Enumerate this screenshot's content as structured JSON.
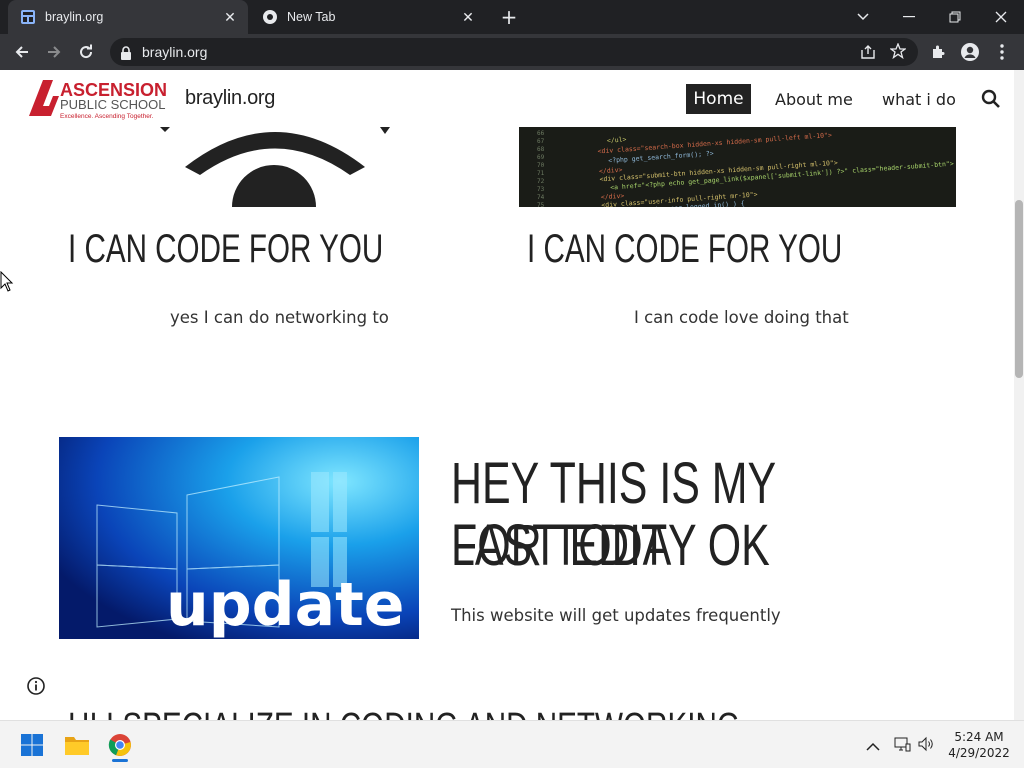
{
  "browser": {
    "tabs": [
      {
        "title": "braylin.org",
        "active": true,
        "icon": "site-favicon"
      },
      {
        "title": "New Tab",
        "active": false,
        "icon": "chrome-icon"
      }
    ],
    "address": "braylin.org"
  },
  "site": {
    "logo": {
      "name": "ASCENSION",
      "subtitle": "PUBLIC SCHOOL",
      "tagline": "Excellence. Ascending Together."
    },
    "title": "braylin.org",
    "nav": [
      {
        "label": "Home",
        "active": true
      },
      {
        "label": "About me",
        "active": false
      },
      {
        "label": "what i do",
        "active": false
      }
    ]
  },
  "content": {
    "card_left": {
      "heading": "I CAN CODE FOR YOU",
      "text": "yes I can do networking  to"
    },
    "card_right": {
      "heading": "I CAN CODE FOR YOU",
      "text": "I can code love doing that"
    },
    "feature": {
      "image_text": "update",
      "heading_line1": "HEY THIS IS MY LAST EDIT",
      "heading_line2": "FOR TODAY OK",
      "text": "This website will get updates frequently"
    },
    "partial_heading": "HI I SPECIALIZE IN CODING AND NETWORKING"
  },
  "taskbar": {
    "time": "5:24 AM",
    "date": "4/29/2022",
    "apps": [
      "windows-start-icon",
      "file-explorer-icon",
      "chrome-icon"
    ]
  },
  "colors": {
    "chrome_dark": "#202124",
    "chrome_toolbar": "#35363a",
    "logo_red": "#c8202f",
    "nav_active_bg": "#222222"
  }
}
